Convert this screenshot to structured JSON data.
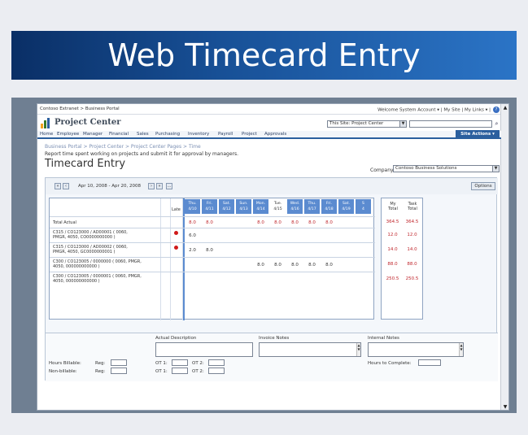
{
  "slide": {
    "title": "Web Timecard Entry"
  },
  "browser": {
    "breadcrumb": "Contoso Extranet > Business Portal",
    "welcome": "Welcome System Account ▾ | My Site | My Links ▾ |",
    "help_icon": "?"
  },
  "site": {
    "title": "Project Center",
    "scope_select": "This Site: Project Center",
    "search_placeholder": ""
  },
  "nav": {
    "items": [
      "Home",
      "Employee",
      "Manager",
      "Financial",
      "Sales",
      "Purchasing",
      "Inventory",
      "Payroll",
      "Project",
      "Approvals"
    ],
    "site_actions": "Site Actions ▾"
  },
  "page": {
    "crumb": "Business Portal > Project Center > Project Center Pages > Time",
    "description": "Report time spent working on projects and submit it for approval by managers.",
    "title": "Timecard Entry",
    "company_label": "Company:",
    "company_value": "Contoso Business Solutions"
  },
  "toolbar": {
    "first": "«",
    "prev": "‹",
    "range": "Apr 10, 2008 - Apr 20, 2008",
    "next": "›",
    "last": "»",
    "more": "...",
    "options": "Options"
  },
  "grid": {
    "late_hrs": "Late Hrs",
    "days": [
      {
        "d": "Thu.",
        "date": "4/10",
        "hl": true
      },
      {
        "d": "Fri.",
        "date": "4/11",
        "hl": true
      },
      {
        "d": "Sat.",
        "date": "4/12",
        "hl": true
      },
      {
        "d": "Sun.",
        "date": "4/13",
        "hl": true
      },
      {
        "d": "Mon.",
        "date": "4/14",
        "hl": true
      },
      {
        "d": "Tue.",
        "date": "4/15",
        "hl": false
      },
      {
        "d": "Wed.",
        "date": "4/16",
        "hl": true
      },
      {
        "d": "Thu.",
        "date": "4/17",
        "hl": true
      },
      {
        "d": "Fri.",
        "date": "4/18",
        "hl": true
      },
      {
        "d": "Sat.",
        "date": "4/19",
        "hl": true
      },
      {
        "d": "S",
        "date": "4",
        "hl": true
      }
    ],
    "total_label": "Total Actual",
    "total_values": [
      "8.0",
      "8.0",
      "",
      "",
      "8.0",
      "8.0",
      "8.0",
      "8.0",
      "8.0",
      "",
      ""
    ],
    "rows": [
      {
        "label1": "C315 / CO123000 / AD00001 ( 0060,",
        "label2": "PMGR, 4050, CO0000000000 )",
        "late": true,
        "values": [
          "6.0",
          "",
          "",
          "",
          "",
          "",
          "",
          "",
          "",
          "",
          ""
        ],
        "my_total": "12.0",
        "task_total": "12.0"
      },
      {
        "label1": "C315 / CO123000 / AD00002 ( 0060,",
        "label2": "PMGR, 4050, GC0000000001 )",
        "late": true,
        "values": [
          "2.0",
          "8.0",
          "",
          "",
          "",
          "",
          "",
          "",
          "",
          "",
          ""
        ],
        "my_total": "14.0",
        "task_total": "14.0"
      },
      {
        "label1": "C300 / CO123005 / 0000000 ( 0060, PMGR,",
        "label2": "4050, 000000000000 )",
        "late": false,
        "values": [
          "",
          "",
          "",
          "",
          "8.0",
          "8.0",
          "8.0",
          "8.0",
          "8.0",
          "",
          ""
        ],
        "my_total": "88.0",
        "task_total": "88.0"
      },
      {
        "label1": "C300 / CO123005 / 0000001 ( 0060, PMGR,",
        "label2": "4050, 000000000000 )",
        "late": false,
        "values": [
          "",
          "",
          "",
          "",
          "",
          "",
          "",
          "",
          "",
          "",
          ""
        ],
        "my_total": "250.5",
        "task_total": "250.5"
      }
    ]
  },
  "totals": {
    "my_total_h1": "My",
    "my_total_h2": "Total",
    "task_total_h1": "Task",
    "task_total_h2": "Total",
    "total_my": "364.5",
    "total_task": "364.5"
  },
  "notes": {
    "actual_description": "Actual Description",
    "invoice_notes": "Invoice Notes",
    "internal_notes": "Internal Notes",
    "hours_billable": "Hours Billable:",
    "non_billable": "Non-billable:",
    "reg": "Reg:",
    "ot1": "OT 1:",
    "ot2": "OT 2:",
    "hours_to_complete": "Hours to Complete:"
  },
  "colors": {
    "brand_blue": "#2b5f9e",
    "day_header": "#5b8bd0",
    "value_red": "#c0262c",
    "late_dot": "#d01a1a"
  }
}
